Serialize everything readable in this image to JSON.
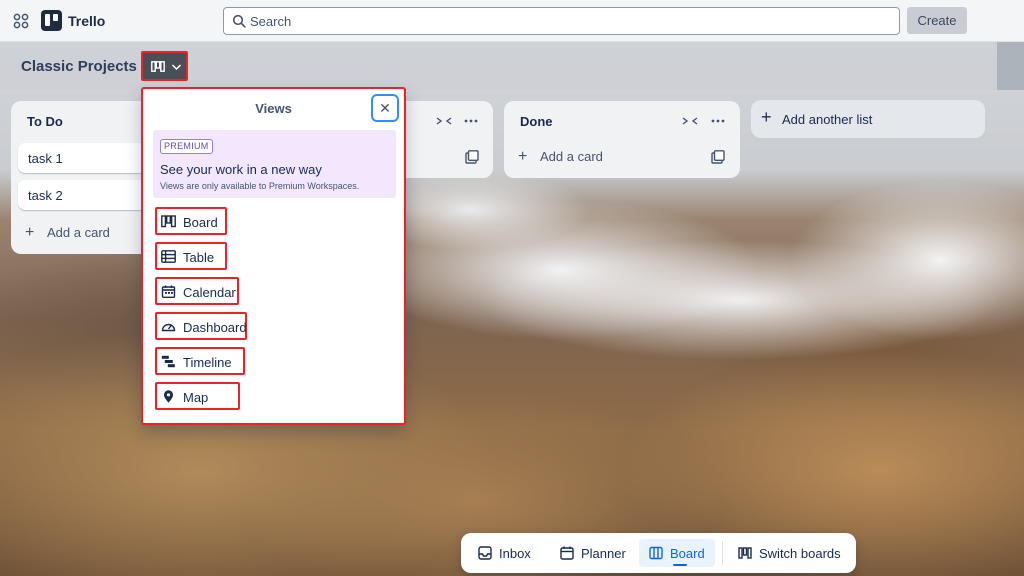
{
  "app": {
    "name": "Trello",
    "search_placeholder": "Search",
    "create_label": "Create"
  },
  "board": {
    "title": "Classic Projects"
  },
  "lists": [
    {
      "title": "To Do",
      "cards": [
        "task 1",
        "task 2"
      ],
      "add_card_label": "Add a card"
    },
    {
      "title": "Done",
      "cards": [],
      "add_card_label": "Add a card"
    }
  ],
  "add_list_label": "Add another list",
  "views_popover": {
    "title": "Views",
    "close_symbol": "✕",
    "premium_badge": "PREMIUM",
    "premium_heading": "See your work in a new way",
    "premium_subtext": "Views are only available to Premium Workspaces.",
    "items": [
      {
        "label": "Board",
        "icon": "board-icon"
      },
      {
        "label": "Table",
        "icon": "table-icon"
      },
      {
        "label": "Calendar",
        "icon": "calendar-icon"
      },
      {
        "label": "Dashboard",
        "icon": "dashboard-icon"
      },
      {
        "label": "Timeline",
        "icon": "timeline-icon"
      },
      {
        "label": "Map",
        "icon": "map-pin-icon"
      }
    ]
  },
  "bottom_nav": {
    "items": [
      {
        "label": "Inbox",
        "icon": "inbox-icon",
        "active": false
      },
      {
        "label": "Planner",
        "icon": "calendar-icon",
        "active": false
      },
      {
        "label": "Board",
        "icon": "board-icon",
        "active": true
      },
      {
        "label": "Switch boards",
        "icon": "switch-boards-icon",
        "active": false
      }
    ]
  },
  "colors": {
    "highlight_outline": "#e8232a",
    "active_blue": "#0c66e4",
    "premium_bg": "#f3e7fd"
  }
}
